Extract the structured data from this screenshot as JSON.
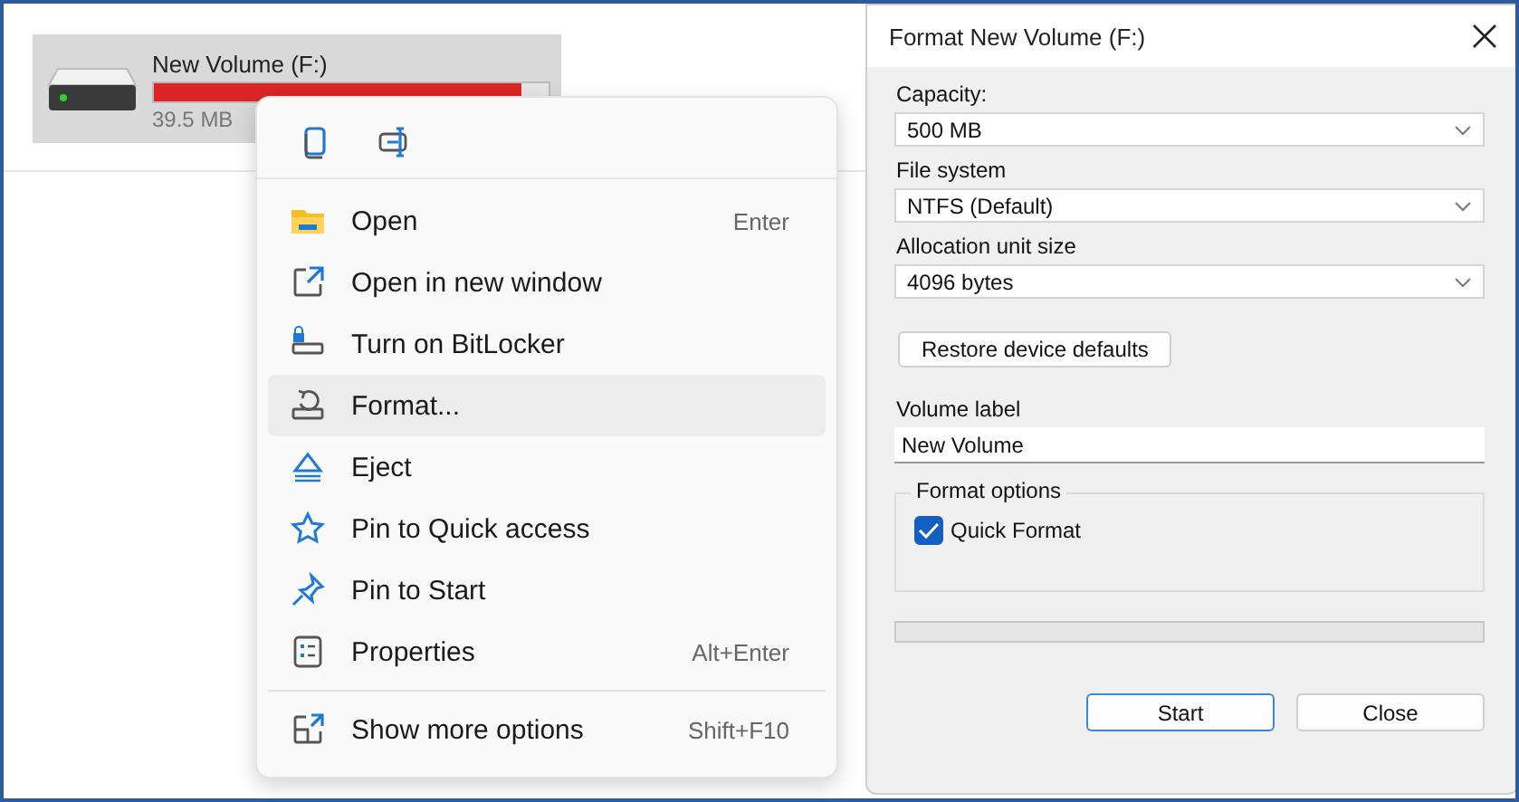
{
  "drive": {
    "name": "New Volume (F:)",
    "level": 0.93,
    "free": "39.5 MB"
  },
  "context_menu": {
    "toolbar": [
      {
        "kind": "copy"
      },
      {
        "kind": "rename"
      }
    ],
    "items": [
      {
        "kind": "folder",
        "label": "Open",
        "shortcut": "Enter",
        "selected": false
      },
      {
        "kind": "newwindow",
        "label": "Open in new window",
        "selected": false
      },
      {
        "kind": "bitlocker",
        "label": "Turn on BitLocker",
        "selected": false
      },
      {
        "kind": "format",
        "label": "Format...",
        "selected": true
      },
      {
        "kind": "eject",
        "label": "Eject",
        "selected": false
      },
      {
        "kind": "star",
        "label": "Pin to Quick access",
        "selected": false
      },
      {
        "kind": "pin",
        "label": "Pin to Start",
        "selected": false
      },
      {
        "kind": "properties",
        "label": "Properties",
        "shortcut": "Alt+Enter",
        "selected": false
      },
      {
        "kind": "more",
        "label": "Show more options",
        "shortcut": "Shift+F10",
        "selected": false,
        "separator_before": true
      }
    ]
  },
  "dialog": {
    "title": "Format New Volume (F:)",
    "dropdowns": [
      {
        "label": "Capacity:",
        "value": "500 MB"
      },
      {
        "label": "File system",
        "value": "NTFS (Default)"
      },
      {
        "label": "Allocation unit size",
        "value": "4096 bytes"
      }
    ],
    "restore_button": "Restore device defaults",
    "volume_label": {
      "label": "Volume label",
      "value": "New Volume"
    },
    "format_options": {
      "title": "Format options",
      "quick_format": {
        "label": "Quick Format",
        "checked": true
      }
    },
    "progress": {
      "level": 0
    },
    "buttons": [
      {
        "label": "Start",
        "default": true
      },
      {
        "label": "Close",
        "default": false
      }
    ]
  }
}
